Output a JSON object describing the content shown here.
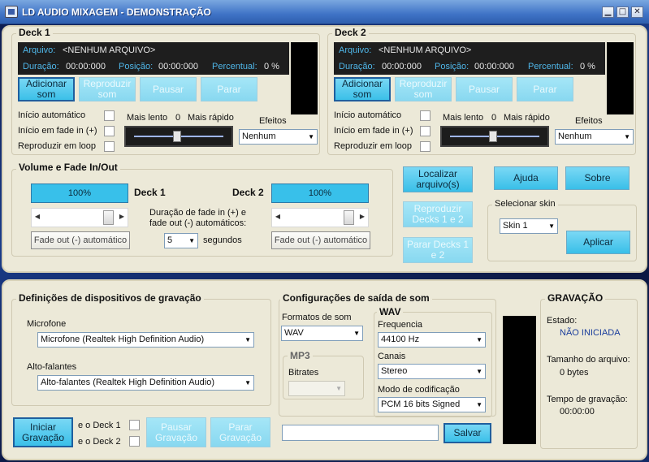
{
  "window": {
    "title": "LD AUDIO MIXAGEM - DEMONSTRAÇÃO",
    "minimize": "▁",
    "maximize": "□",
    "close": "✕"
  },
  "deck1": {
    "title": "Deck 1",
    "file_label": "Arquivo:",
    "file_value": "<NENHUM ARQUIVO>",
    "duration_label": "Duração:",
    "duration_value": "00:00:000",
    "position_label": "Posição:",
    "position_value": "00:00:000",
    "percent_label": "Percentual:",
    "percent_value": "0 %",
    "add_btn": "Adicionar som",
    "play_btn": "Reproduzir som",
    "pause_btn": "Pausar",
    "stop_btn": "Parar",
    "auto_start": "Início automático",
    "fade_start": "Início em fade in (+)",
    "loop": "Reproduzir em loop",
    "slower": "Mais lento",
    "speed_value": "0",
    "faster": "Mais rápido",
    "effects_label": "Efeitos",
    "effects_value": "Nenhum"
  },
  "deck2": {
    "title": "Deck 2",
    "file_label": "Arquivo:",
    "file_value": "<NENHUM ARQUIVO>",
    "duration_label": "Duração:",
    "duration_value": "00:00:000",
    "position_label": "Posição:",
    "position_value": "00:00:000",
    "percent_label": "Percentual:",
    "percent_value": "0 %",
    "add_btn": "Adicionar som",
    "play_btn": "Reproduzir som",
    "pause_btn": "Pausar",
    "stop_btn": "Parar",
    "auto_start": "Início automático",
    "fade_start": "Início em fade in (+)",
    "loop": "Reproduzir em loop",
    "slower": "Mais lento",
    "speed_value": "0",
    "faster": "Mais rápido",
    "effects_label": "Efeitos",
    "effects_value": "Nenhum"
  },
  "volume": {
    "title": "Volume e Fade In/Out",
    "deck1_level": "100%",
    "deck2_level": "100%",
    "deck1_label": "Deck 1",
    "deck2_label": "Deck 2",
    "fade_desc": "Duração de fade in (+) e fade out (-) automáticos:",
    "fade_seconds": "5",
    "seconds_label": "segundos",
    "fade_out_btn": "Fade out (-) automático"
  },
  "actions": {
    "locate_btn": "Localizar arquivo(s)",
    "help_btn": "Ajuda",
    "about_btn": "Sobre",
    "play_both_btn": "Reproduzir Decks 1 e 2",
    "stop_both_btn": "Parar Decks 1 e 2",
    "skin_label": "Selecionar skin",
    "skin_value": "Skin 1",
    "apply_btn": "Aplicar"
  },
  "devices": {
    "title": "Definições de dispositivos de gravação",
    "mic_label": "Microfone",
    "mic_value": "Microfone (Realtek High Definition Audio)",
    "spk_label": "Alto-falantes",
    "spk_value": "Alto-falantes (Realtek High Definition Audio)"
  },
  "record": {
    "start_btn": "Iniciar Gravação",
    "deck1_opt": "e o Deck 1",
    "deck2_opt": "e o Deck 2",
    "pause_btn": "Pausar Gravação",
    "stop_btn": "Parar Gravação"
  },
  "output": {
    "title": "Configurações de saída de som",
    "formats_label": "Formatos de som",
    "format_value": "WAV",
    "wav_title": "WAV",
    "freq_label": "Frequencia",
    "freq_value": "44100 Hz",
    "channels_label": "Canais",
    "channels_value": "Stereo",
    "codec_label": "Modo de codificação",
    "codec_value": "PCM 16 bits Signed",
    "mp3_title": "MP3",
    "bitrates_label": "Bitrates",
    "bitrate_value": "",
    "save_btn": "Salvar",
    "save_path": ""
  },
  "recording": {
    "title": "GRAVAÇÃO",
    "state_label": "Estado:",
    "state_value": "NÃO INICIADA",
    "size_label": "Tamanho do arquivo:",
    "size_value": "0 bytes",
    "time_label": "Tempo de gravação:",
    "time_value": "00:00:00"
  }
}
